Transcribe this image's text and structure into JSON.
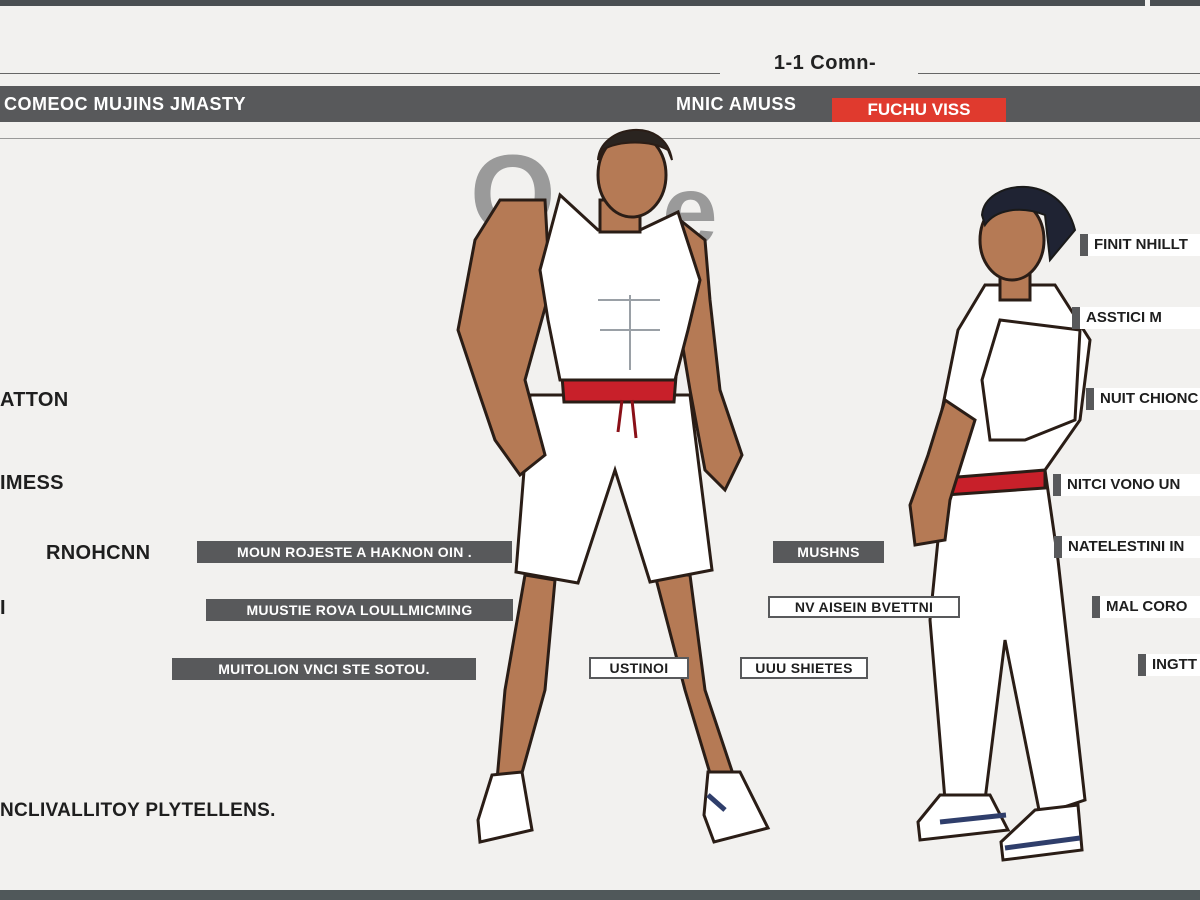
{
  "header": {
    "page_number": "1-1 Comn-",
    "left_title": "COMEOC MUJINS JMASTY",
    "mid_title": "MNIC AMUSS",
    "tag": "FUCHU VISS"
  },
  "big_letters": {
    "first": "O",
    "second": "e"
  },
  "left_labels": [
    "ATTON",
    "IMESS",
    "RNOHCNN",
    "I",
    "NCLIVALLITOY PLYTELLENS."
  ],
  "callouts_left": [
    "MOUN ROJESTE A HAKNON OIN .",
    "MUUSTIE ROVA LOULLMICMING",
    "MUITOLION VNCI STE SOTOU."
  ],
  "callouts_mid": [
    "MUSHNS",
    "NV AISEIN BVETTNI",
    "USTINOI",
    "UUU SHIETES"
  ],
  "callouts_right": [
    "FINIT NHILLT",
    "ASSTICI M",
    "NUIT CHIONC",
    "NITCI VONO UN",
    "NATELESTINI IN",
    "MAL CORO",
    "INGTT"
  ],
  "colors": {
    "background": "#f2f1ef",
    "band": "#58595b",
    "accent_red": "#e03a2e",
    "skin": "#b57a55",
    "outfit": "#ffffff"
  }
}
